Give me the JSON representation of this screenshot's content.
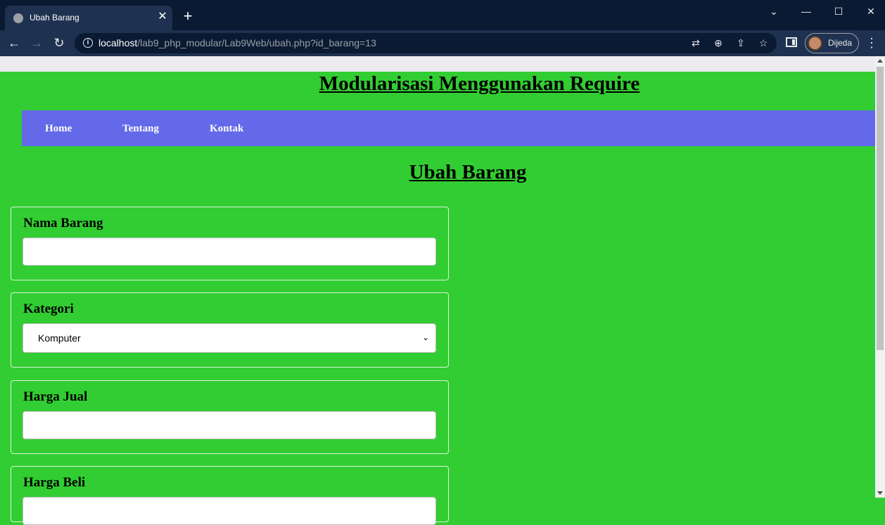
{
  "browser": {
    "tab_title": "Ubah Barang",
    "tab_close": "✕",
    "new_tab": "+",
    "window": {
      "dropdown": "⌄",
      "minimize": "—",
      "maximize": "☐",
      "close": "✕"
    },
    "nav": {
      "back": "←",
      "forward": "→",
      "reload": "↻"
    },
    "url_host": "localhost",
    "url_path": "/lab9_php_modular/Lab9Web/ubah.php?id_barang=13",
    "omni_icons": {
      "translate": "⇄",
      "zoom": "⊕",
      "share": "⇪",
      "bookmark": "☆"
    },
    "profile_name": "Dijeda",
    "menu": "⋮"
  },
  "page": {
    "site_title": "Modularisasi Menggunakan Require",
    "nav": [
      "Home",
      "Tentang",
      "Kontak"
    ],
    "heading": "Ubah Barang",
    "form": {
      "fields": [
        {
          "label": "Nama Barang",
          "value": ""
        },
        {
          "label": "Kategori",
          "selected": "Komputer"
        },
        {
          "label": "Harga Jual",
          "value": ""
        },
        {
          "label": "Harga Beli",
          "value": ""
        }
      ],
      "select_caret": "⌄"
    }
  },
  "colors": {
    "page_bg": "#32cd32",
    "nav_bg": "#6369e8",
    "browser_frame": "#0b1a33",
    "browser_toolbar": "#1f3150"
  }
}
